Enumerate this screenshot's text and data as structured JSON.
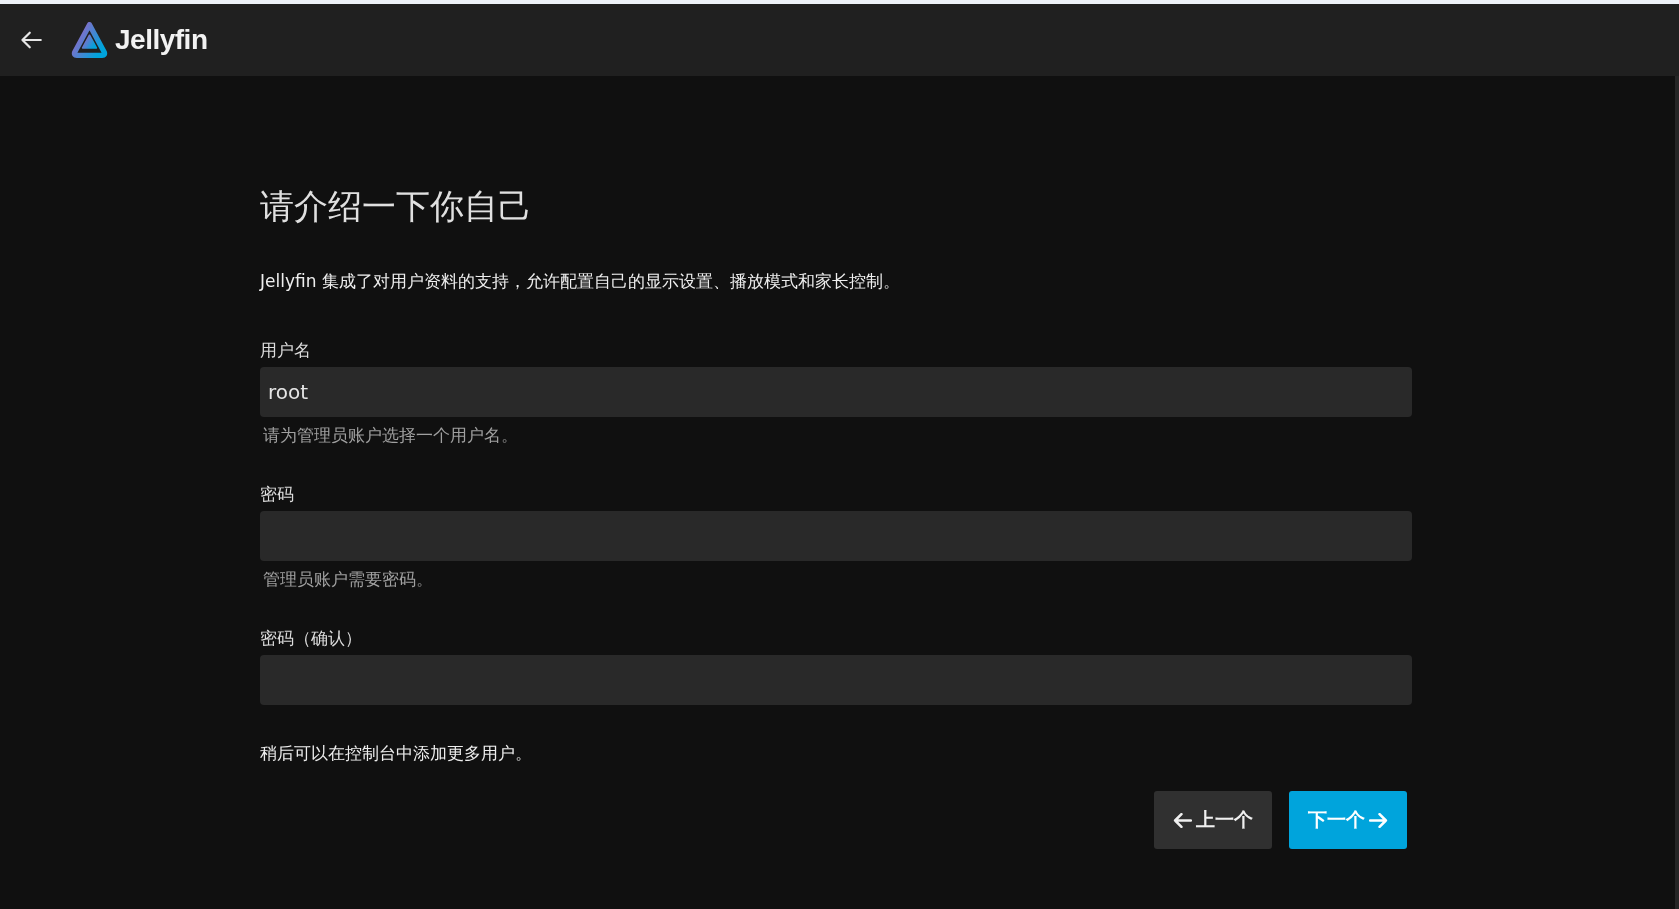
{
  "header": {
    "app_name": "Jellyfin"
  },
  "page": {
    "title": "请介绍一下你自己",
    "description": "Jellyfin 集成了对用户资料的支持，允许配置自己的显示设置、播放模式和家长控制。",
    "fields": [
      {
        "label": "用户名",
        "value": "root",
        "help": "请为管理员账户选择一个用户名。"
      },
      {
        "label": "密码",
        "help": "管理员账户需要密码。"
      },
      {
        "label": "密码（确认）"
      }
    ],
    "note": "稍后可以在控制台中添加更多用户。",
    "buttons": [
      {
        "label": "上一个",
        "kind": "back"
      },
      {
        "label": "下一个",
        "kind": "next"
      }
    ]
  }
}
